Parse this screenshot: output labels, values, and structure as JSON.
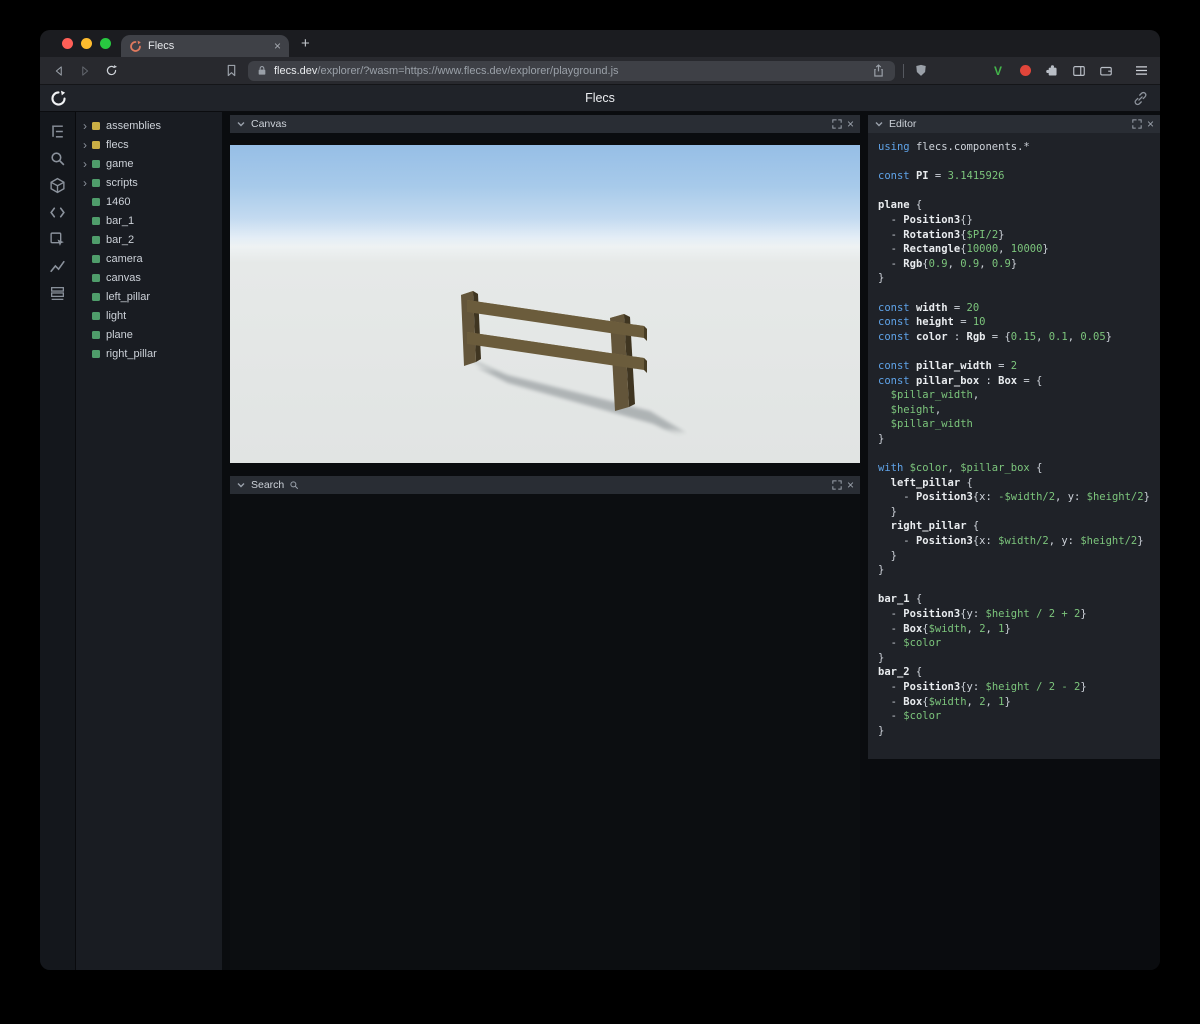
{
  "browser": {
    "tab_title": "Flecs",
    "url_domain": "flecs.dev",
    "url_rest": "/explorer/?wasm=https://www.flecs.dev/explorer/playground.js"
  },
  "app": {
    "title": "Flecs"
  },
  "glyphs": {
    "close": "×",
    "new_tab": "+",
    "tree_expand": "›"
  },
  "sidebar": {
    "icons": [
      "tree",
      "search",
      "entities",
      "code",
      "inspect",
      "stats",
      "tables"
    ]
  },
  "tree": {
    "items": [
      {
        "label": "assemblies",
        "kind": "module",
        "expandable": true
      },
      {
        "label": "flecs",
        "kind": "module",
        "expandable": true
      },
      {
        "label": "game",
        "kind": "entity",
        "expandable": true
      },
      {
        "label": "scripts",
        "kind": "entity",
        "expandable": true
      },
      {
        "label": "1460",
        "kind": "entity",
        "expandable": false
      },
      {
        "label": "bar_1",
        "kind": "entity",
        "expandable": false
      },
      {
        "label": "bar_2",
        "kind": "entity",
        "expandable": false
      },
      {
        "label": "camera",
        "kind": "entity",
        "expandable": false
      },
      {
        "label": "canvas",
        "kind": "entity",
        "expandable": false
      },
      {
        "label": "left_pillar",
        "kind": "entity",
        "expandable": false
      },
      {
        "label": "light",
        "kind": "entity",
        "expandable": false
      },
      {
        "label": "plane",
        "kind": "entity",
        "expandable": false
      },
      {
        "label": "right_pillar",
        "kind": "entity",
        "expandable": false
      }
    ]
  },
  "panels": {
    "canvas": {
      "title": "Canvas"
    },
    "search": {
      "title": "Search"
    },
    "editor": {
      "title": "Editor"
    }
  },
  "editor": {
    "lines": [
      [
        {
          "c": "k",
          "t": "using "
        },
        {
          "c": "p",
          "t": "flecs.components.*"
        }
      ],
      [],
      [
        {
          "c": "k",
          "t": "const "
        },
        {
          "c": "b",
          "t": "PI"
        },
        {
          "c": "p",
          "t": " = "
        },
        {
          "c": "g",
          "t": "3.1415926"
        }
      ],
      [],
      [
        {
          "c": "b",
          "t": "plane"
        },
        {
          "c": "p",
          "t": " {"
        }
      ],
      [
        {
          "c": "p",
          "t": "  - "
        },
        {
          "c": "b",
          "t": "Position3"
        },
        {
          "c": "p",
          "t": "{}"
        }
      ],
      [
        {
          "c": "p",
          "t": "  - "
        },
        {
          "c": "b",
          "t": "Rotation3"
        },
        {
          "c": "p",
          "t": "{"
        },
        {
          "c": "g",
          "t": "$PI/2"
        },
        {
          "c": "p",
          "t": "}"
        }
      ],
      [
        {
          "c": "p",
          "t": "  - "
        },
        {
          "c": "b",
          "t": "Rectangle"
        },
        {
          "c": "p",
          "t": "{"
        },
        {
          "c": "g",
          "t": "10000"
        },
        {
          "c": "p",
          "t": ", "
        },
        {
          "c": "g",
          "t": "10000"
        },
        {
          "c": "p",
          "t": "}"
        }
      ],
      [
        {
          "c": "p",
          "t": "  - "
        },
        {
          "c": "b",
          "t": "Rgb"
        },
        {
          "c": "p",
          "t": "{"
        },
        {
          "c": "g",
          "t": "0.9"
        },
        {
          "c": "p",
          "t": ", "
        },
        {
          "c": "g",
          "t": "0.9"
        },
        {
          "c": "p",
          "t": ", "
        },
        {
          "c": "g",
          "t": "0.9"
        },
        {
          "c": "p",
          "t": "}"
        }
      ],
      [
        {
          "c": "p",
          "t": "}"
        }
      ],
      [],
      [
        {
          "c": "k",
          "t": "const "
        },
        {
          "c": "b",
          "t": "width"
        },
        {
          "c": "p",
          "t": " = "
        },
        {
          "c": "g",
          "t": "20"
        }
      ],
      [
        {
          "c": "k",
          "t": "const "
        },
        {
          "c": "b",
          "t": "height"
        },
        {
          "c": "p",
          "t": " = "
        },
        {
          "c": "g",
          "t": "10"
        }
      ],
      [
        {
          "c": "k",
          "t": "const "
        },
        {
          "c": "b",
          "t": "color"
        },
        {
          "c": "p",
          "t": " : "
        },
        {
          "c": "b",
          "t": "Rgb"
        },
        {
          "c": "p",
          "t": " = {"
        },
        {
          "c": "g",
          "t": "0.15"
        },
        {
          "c": "p",
          "t": ", "
        },
        {
          "c": "g",
          "t": "0.1"
        },
        {
          "c": "p",
          "t": ", "
        },
        {
          "c": "g",
          "t": "0.05"
        },
        {
          "c": "p",
          "t": "}"
        }
      ],
      [],
      [
        {
          "c": "k",
          "t": "const "
        },
        {
          "c": "b",
          "t": "pillar_width"
        },
        {
          "c": "p",
          "t": " = "
        },
        {
          "c": "g",
          "t": "2"
        }
      ],
      [
        {
          "c": "k",
          "t": "const "
        },
        {
          "c": "b",
          "t": "pillar_box"
        },
        {
          "c": "p",
          "t": " : "
        },
        {
          "c": "b",
          "t": "Box"
        },
        {
          "c": "p",
          "t": " = {"
        }
      ],
      [
        {
          "c": "p",
          "t": "  "
        },
        {
          "c": "g",
          "t": "$pillar_width"
        },
        {
          "c": "p",
          "t": ","
        }
      ],
      [
        {
          "c": "p",
          "t": "  "
        },
        {
          "c": "g",
          "t": "$height"
        },
        {
          "c": "p",
          "t": ","
        }
      ],
      [
        {
          "c": "p",
          "t": "  "
        },
        {
          "c": "g",
          "t": "$pillar_width"
        }
      ],
      [
        {
          "c": "p",
          "t": "}"
        }
      ],
      [],
      [
        {
          "c": "k",
          "t": "with "
        },
        {
          "c": "g",
          "t": "$color"
        },
        {
          "c": "p",
          "t": ", "
        },
        {
          "c": "g",
          "t": "$pillar_box"
        },
        {
          "c": "p",
          "t": " {"
        }
      ],
      [
        {
          "c": "p",
          "t": "  "
        },
        {
          "c": "b",
          "t": "left_pillar"
        },
        {
          "c": "p",
          "t": " {"
        }
      ],
      [
        {
          "c": "p",
          "t": "    - "
        },
        {
          "c": "b",
          "t": "Position3"
        },
        {
          "c": "p",
          "t": "{x: "
        },
        {
          "c": "g",
          "t": "-$width/2"
        },
        {
          "c": "p",
          "t": ", y: "
        },
        {
          "c": "g",
          "t": "$height/2"
        },
        {
          "c": "p",
          "t": "}"
        }
      ],
      [
        {
          "c": "p",
          "t": "  }"
        }
      ],
      [
        {
          "c": "p",
          "t": "  "
        },
        {
          "c": "b",
          "t": "right_pillar"
        },
        {
          "c": "p",
          "t": " {"
        }
      ],
      [
        {
          "c": "p",
          "t": "    - "
        },
        {
          "c": "b",
          "t": "Position3"
        },
        {
          "c": "p",
          "t": "{x: "
        },
        {
          "c": "g",
          "t": "$width/2"
        },
        {
          "c": "p",
          "t": ", y: "
        },
        {
          "c": "g",
          "t": "$height/2"
        },
        {
          "c": "p",
          "t": "}"
        }
      ],
      [
        {
          "c": "p",
          "t": "  }"
        }
      ],
      [
        {
          "c": "p",
          "t": "}"
        }
      ],
      [],
      [
        {
          "c": "b",
          "t": "bar_1"
        },
        {
          "c": "p",
          "t": " {"
        }
      ],
      [
        {
          "c": "p",
          "t": "  - "
        },
        {
          "c": "b",
          "t": "Position3"
        },
        {
          "c": "p",
          "t": "{y: "
        },
        {
          "c": "g",
          "t": "$height / 2 + 2"
        },
        {
          "c": "p",
          "t": "}"
        }
      ],
      [
        {
          "c": "p",
          "t": "  - "
        },
        {
          "c": "b",
          "t": "Box"
        },
        {
          "c": "p",
          "t": "{"
        },
        {
          "c": "g",
          "t": "$width"
        },
        {
          "c": "p",
          "t": ", "
        },
        {
          "c": "g",
          "t": "2"
        },
        {
          "c": "p",
          "t": ", "
        },
        {
          "c": "g",
          "t": "1"
        },
        {
          "c": "p",
          "t": "}"
        }
      ],
      [
        {
          "c": "p",
          "t": "  - "
        },
        {
          "c": "g",
          "t": "$color"
        }
      ],
      [
        {
          "c": "p",
          "t": "}"
        }
      ],
      [
        {
          "c": "b",
          "t": "bar_2"
        },
        {
          "c": "p",
          "t": " {"
        }
      ],
      [
        {
          "c": "p",
          "t": "  - "
        },
        {
          "c": "b",
          "t": "Position3"
        },
        {
          "c": "p",
          "t": "{y: "
        },
        {
          "c": "g",
          "t": "$height / 2 - 2"
        },
        {
          "c": "p",
          "t": "}"
        }
      ],
      [
        {
          "c": "p",
          "t": "  - "
        },
        {
          "c": "b",
          "t": "Box"
        },
        {
          "c": "p",
          "t": "{"
        },
        {
          "c": "g",
          "t": "$width"
        },
        {
          "c": "p",
          "t": ", "
        },
        {
          "c": "g",
          "t": "2"
        },
        {
          "c": "p",
          "t": ", "
        },
        {
          "c": "g",
          "t": "1"
        },
        {
          "c": "p",
          "t": "}"
        }
      ],
      [
        {
          "c": "p",
          "t": "  - "
        },
        {
          "c": "g",
          "t": "$color"
        }
      ],
      [
        {
          "c": "p",
          "t": "}"
        }
      ]
    ]
  },
  "colors": {
    "module": "#c9ae45",
    "entity": "#4f9d6b",
    "keyword": "#5fa3e8",
    "value": "#7cc57c",
    "plain": "#ced3da",
    "ident": "#e9ecef",
    "vimium_green": "#43b54a",
    "extension_red": "#e0453a"
  }
}
